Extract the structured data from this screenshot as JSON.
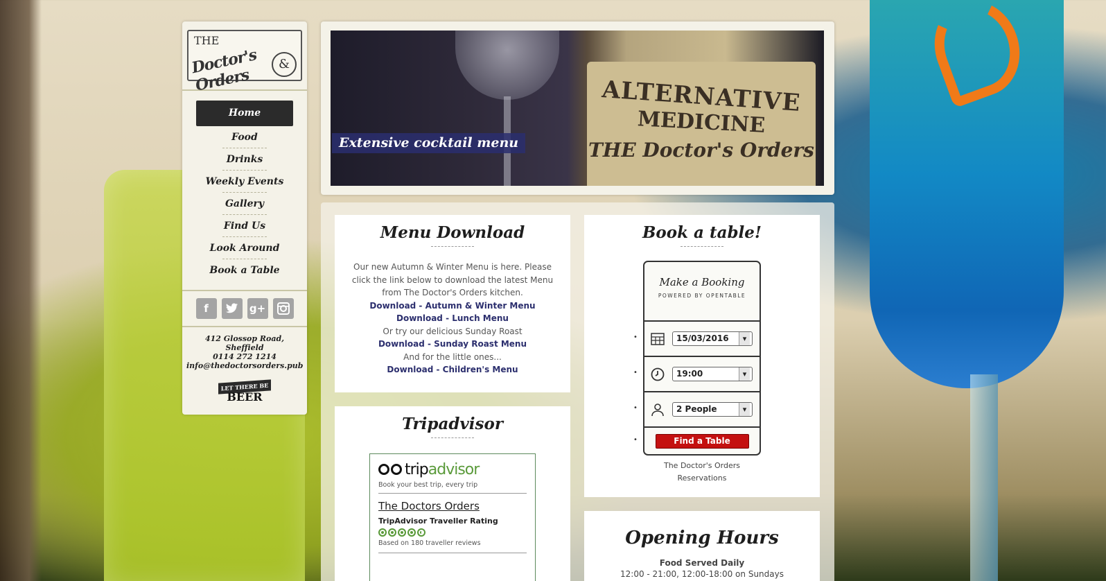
{
  "colors": {
    "nav_active_bg": "#2b2b2b",
    "link": "#2c2f6e",
    "find_button": "#c41010",
    "tripadvisor_green": "#5a9a3a"
  },
  "logo": {
    "the": "THE",
    "main": "Doctor's Orders",
    "amp": "&"
  },
  "nav": {
    "items": [
      {
        "label": "Home",
        "active": true
      },
      {
        "label": "Food"
      },
      {
        "label": "Drinks"
      },
      {
        "label": "Weekly Events"
      },
      {
        "label": "Gallery"
      },
      {
        "label": "Find Us"
      },
      {
        "label": "Look Around"
      },
      {
        "label": "Book a Table"
      }
    ]
  },
  "social": [
    {
      "name": "facebook-icon",
      "glyph": "f"
    },
    {
      "name": "twitter-icon",
      "glyph": "t"
    },
    {
      "name": "google-plus-icon",
      "glyph": "g+"
    },
    {
      "name": "instagram-icon",
      "glyph": "◙"
    }
  ],
  "contact": {
    "address": "412 Glossop Road, Sheffield",
    "phone": "0114 272 1214",
    "email": "info@thedoctorsorders.pub",
    "badge_ribbon": "LET THERE BE",
    "badge_word": "BEER"
  },
  "hero": {
    "label_line1": "ALTERNATIVE",
    "label_line2": "MEDICINE",
    "label_line3": "THE Doctor's Orders",
    "caption": "Extensive cocktail menu"
  },
  "menu_download": {
    "title": "Menu Download",
    "intro": "Our new Autumn & Winter Menu is here. Please click the link below to download the latest Menu from The Doctor's Orders kitchen.",
    "link1": "Download - Autumn & Winter Menu",
    "link2": "Download - Lunch Menu",
    "text2": "Or try our delicious Sunday Roast",
    "link3": "Download - Sunday Roast Menu",
    "text3": "And for the little ones...",
    "link4": "Download - Children's Menu"
  },
  "booking": {
    "title": "Book a table!",
    "widget_title": "Make a Booking",
    "widget_sub": "POWERED BY OPENTABLE",
    "date": "15/03/2016",
    "time": "19:00",
    "party": "2 People",
    "button": "Find a Table",
    "footer_line1": "The Doctor's Orders",
    "footer_line2": "Reservations"
  },
  "tripadvisor": {
    "title": "Tripadvisor",
    "logo_trip": "trip",
    "logo_advisor": "advisor",
    "tagline": "Book your best trip, every trip",
    "name": "The Doctors Orders",
    "rating_label": "TripAdvisor Traveller Rating",
    "rating": 4.5,
    "based": "Based on 180 traveller reviews"
  },
  "hours": {
    "title": "Opening Hours",
    "sub": "Food Served Daily",
    "line": "12:00 - 21:00, 12:00-18:00 on Sundays"
  }
}
